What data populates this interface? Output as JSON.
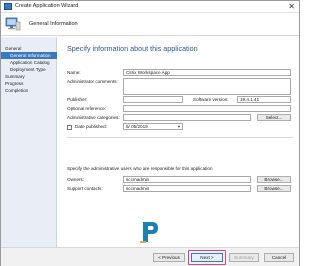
{
  "window": {
    "title": "Create Application Wizard",
    "close_glyph": "✕"
  },
  "header": {
    "title": "General Information",
    "icon": "computer-icon"
  },
  "nav": {
    "items": [
      {
        "label": "General",
        "level": 0,
        "active": false
      },
      {
        "label": "General Information",
        "level": 1,
        "active": true
      },
      {
        "label": "Application Catalog",
        "level": 1,
        "active": false
      },
      {
        "label": "Deployment Type",
        "level": 1,
        "active": false
      },
      {
        "label": "Summary",
        "level": 0,
        "active": false
      },
      {
        "label": "Progress",
        "level": 0,
        "active": false
      },
      {
        "label": "Completion",
        "level": 0,
        "active": false
      }
    ]
  },
  "main": {
    "heading": "Specify information about this application",
    "name": {
      "label": "Name:",
      "value": "Citrix Workspace App"
    },
    "admin_comments": {
      "label": "Administrator comments:",
      "value": ""
    },
    "publisher": {
      "label": "Publisher:",
      "value": ""
    },
    "software_version": {
      "label": "Software version:",
      "value": "19.4.1.41"
    },
    "optional_reference": {
      "label": "Optional reference:",
      "value": ""
    },
    "admin_categories": {
      "label": "Administrative categories:",
      "value": "",
      "button": "Select..."
    },
    "date_published": {
      "label": "Date published:",
      "value": "5/ 05/2019",
      "checked": false
    },
    "owners_caption": "Specify the administrative users who are responsible for this application",
    "owners": {
      "label": "Owners:",
      "value": "sccmadmin",
      "button": "Browse..."
    },
    "support_contacts": {
      "label": "Support contacts:",
      "value": "sccmadmin",
      "button": "Browse..."
    }
  },
  "footer": {
    "previous": "< Previous",
    "next": "Next >",
    "summary": "Summary",
    "cancel": "Cancel"
  },
  "colors": {
    "accent": "#3a78c0",
    "heading": "#2a5a9a",
    "highlight": "#d9467a",
    "logo": "#1e7fb5"
  }
}
